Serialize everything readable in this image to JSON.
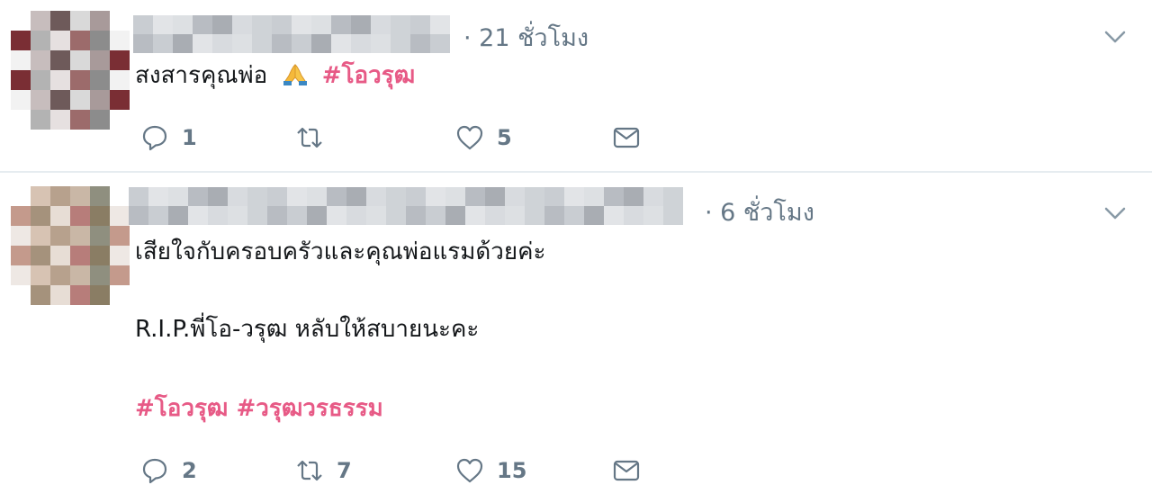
{
  "tweets": [
    {
      "time": "· 21 ชั่วโมง",
      "text_line": "สงสารคุณพ่อ",
      "hashtags": "#โอวรุฒ",
      "emoji": "folded-hands-emoji",
      "replies": "1",
      "retweets": "",
      "likes": "5"
    },
    {
      "time": "· 6 ชั่วโมง",
      "line1": "เสียใจกับครอบครัวและคุณพ่อแรมด้วยค่ะ",
      "line2": "R.I.P.พี่โอ-วรุฒ หลับให้สบายนะคะ",
      "hashtags": "#โอวรุฒ #วรุฒวรธรรม",
      "replies": "2",
      "retweets": "7",
      "likes": "15"
    }
  ],
  "colors": {
    "hashtag": "#e0245e",
    "meta": "#657786",
    "divider": "#e6ecf0"
  }
}
